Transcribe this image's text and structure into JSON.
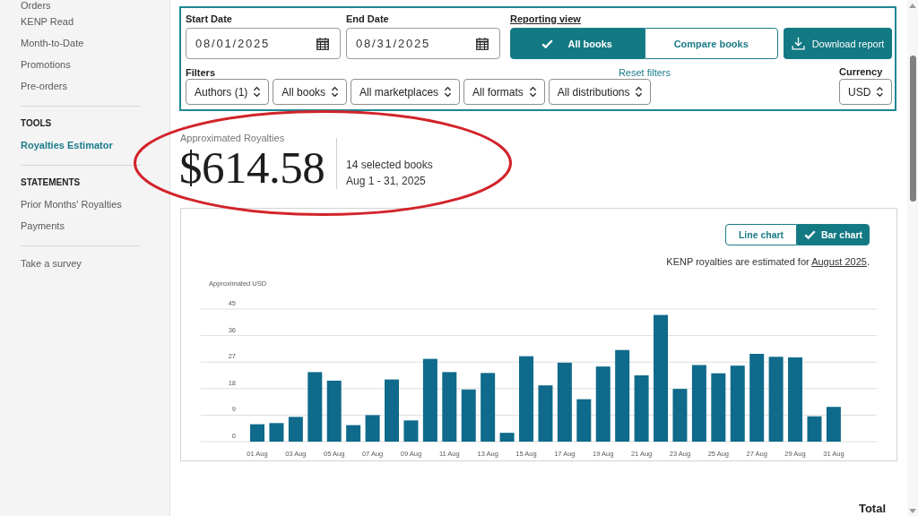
{
  "sidebar": {
    "groups": [
      {
        "items": [
          {
            "label": "Orders",
            "selected": false
          },
          {
            "label": "KENP Read",
            "selected": false
          },
          {
            "label": "Month-to-Date",
            "selected": false
          },
          {
            "label": "Promotions",
            "selected": false
          },
          {
            "label": "Pre-orders",
            "selected": false
          }
        ]
      },
      {
        "heading": "TOOLS",
        "items": [
          {
            "label": "Royalties Estimator",
            "selected": true
          }
        ]
      },
      {
        "heading": "STATEMENTS",
        "items": [
          {
            "label": "Prior Months' Royalties",
            "selected": false
          },
          {
            "label": "Payments",
            "selected": false
          }
        ]
      },
      {
        "items": [
          {
            "label": "Take a survey",
            "selected": false
          }
        ]
      }
    ]
  },
  "filters_panel": {
    "start_date": {
      "label": "Start Date",
      "value": "08/01/2025"
    },
    "end_date": {
      "label": "End Date",
      "value": "08/31/2025"
    },
    "reporting_view": {
      "label": "Reporting view",
      "options": [
        {
          "label": "All books",
          "selected": true
        },
        {
          "label": "Compare books",
          "selected": false
        }
      ]
    },
    "download_button": "Download report",
    "filters_label": "Filters",
    "reset_link": "Reset filters",
    "filters": [
      "Authors (1)",
      "All books",
      "All marketplaces",
      "All formats",
      "All distributions"
    ],
    "currency": {
      "label": "Currency",
      "value": "USD"
    }
  },
  "summary": {
    "label": "Approximated Royalties",
    "amount": "$614.58",
    "books": "14 selected books",
    "period": "Aug 1 - 31, 2025"
  },
  "chart_card": {
    "toggle": [
      {
        "label": "Line chart",
        "selected": false
      },
      {
        "label": "Bar chart",
        "selected": true
      }
    ],
    "note": {
      "text": "KENP royalties are estimated for",
      "link": "August 2025",
      "end": "."
    },
    "chart_data": {
      "type": "bar",
      "ylabel": "Approximated USD",
      "categories": [
        "01 Aug",
        null,
        "03 Aug",
        null,
        "05 Aug",
        null,
        "07 Aug",
        null,
        "09 Aug",
        null,
        "11 Aug",
        null,
        "13 Aug",
        null,
        "15 Aug",
        null,
        "17 Aug",
        null,
        "19 Aug",
        null,
        "21 Aug",
        null,
        "23 Aug",
        null,
        "25 Aug",
        null,
        "27 Aug",
        null,
        "29 Aug",
        null,
        "31 Aug"
      ],
      "values": [
        5.9,
        6.3,
        8.4,
        23.6,
        20.7,
        5.6,
        9.0,
        21.1,
        7.2,
        28.1,
        23.6,
        17.7,
        23.3,
        3.0,
        29.0,
        19.1,
        26.8,
        14.4,
        25.5,
        31.1,
        22.5,
        43.0,
        17.9,
        26.0,
        23.2,
        25.8,
        29.8,
        28.8,
        28.6,
        8.6,
        11.8
      ],
      "ylim": [
        0,
        45
      ],
      "yticks": [
        0,
        9,
        18,
        27,
        36,
        45
      ],
      "grid": true
    }
  },
  "totals_heading": "Total"
}
